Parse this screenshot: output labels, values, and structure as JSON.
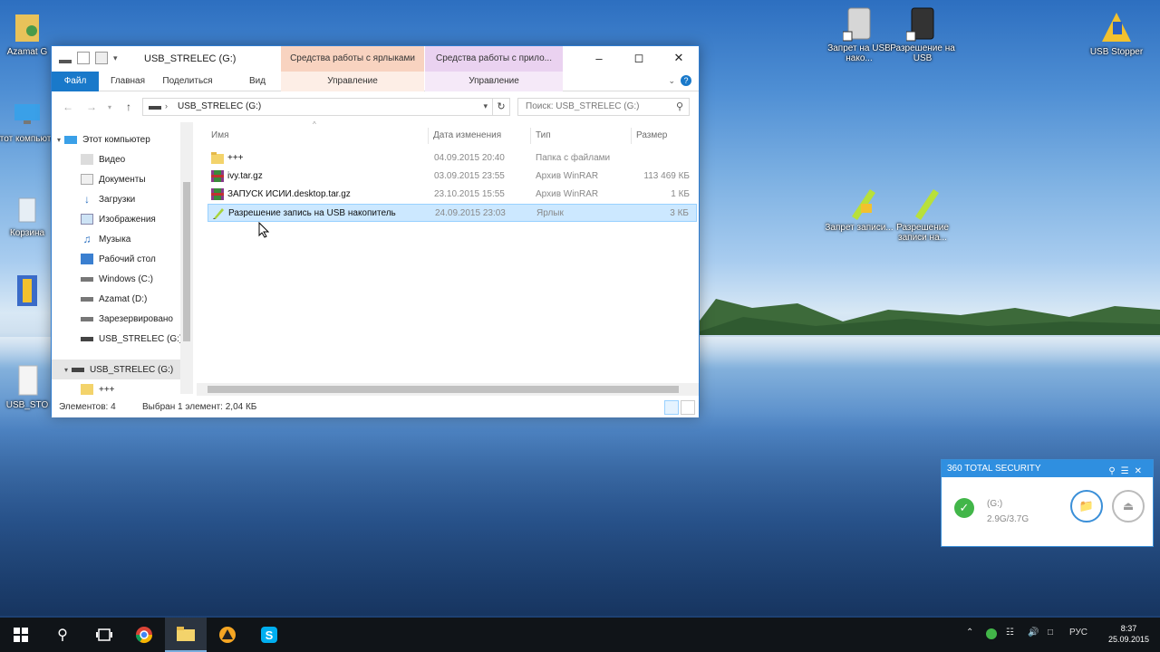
{
  "desktop": {
    "icons": [
      {
        "label": "Azamat G",
        "icon": "user-folder-icon"
      },
      {
        "label": "Этот компьютер",
        "icon": "computer-icon"
      },
      {
        "label": "Корзина",
        "icon": "recycle-bin-icon"
      },
      {
        "label": "",
        "icon": "archive-icon"
      },
      {
        "label": "USB_STO",
        "icon": "file-icon"
      },
      {
        "label": "Запрет на USB нако...",
        "icon": "usb-drive-shortcut-icon"
      },
      {
        "label": "Разрешение на USB",
        "icon": "usb-drive-shortcut-icon"
      },
      {
        "label": "USB Stopper",
        "icon": "usb-stopper-icon"
      },
      {
        "label": "Запрет записи...",
        "icon": "marker-lock-icon"
      },
      {
        "label": "Разрешение записи на...",
        "icon": "marker-icon"
      }
    ]
  },
  "explorer": {
    "title": "USB_STRELEC (G:)",
    "context_tabs": [
      "Средства работы с ярлыками",
      "Средства работы с прило..."
    ],
    "ribbon_tabs": [
      "Файл",
      "Главная",
      "Поделиться",
      "Вид",
      "Управление",
      "Управление"
    ],
    "address": "USB_STRELEC (G:)",
    "search_placeholder": "Поиск: USB_STRELEC (G:)",
    "nav_items": [
      "Этот компьютер",
      "Видео",
      "Документы",
      "Загрузки",
      "Изображения",
      "Музыка",
      "Рабочий стол",
      "Windows (C:)",
      "Azamat (D:)",
      "Зарезервировано",
      "USB_STRELEC (G:)",
      "USB_STRELEC (G:)",
      "+++"
    ],
    "columns": [
      "Имя",
      "Дата изменения",
      "Тип",
      "Размер"
    ],
    "files": [
      {
        "name": "+++",
        "date": "04.09.2015 20:40",
        "type": "Папка с файлами",
        "size": "",
        "icon": "folder-icon"
      },
      {
        "name": "ivy.tar.gz",
        "date": "03.09.2015 23:55",
        "type": "Архив WinRAR",
        "size": "113 469 КБ",
        "icon": "winrar-icon"
      },
      {
        "name": "ЗАПУСК ИСИИ.desktop.tar.gz",
        "date": "23.10.2015 15:55",
        "type": "Архив WinRAR",
        "size": "1 КБ",
        "icon": "winrar-icon"
      },
      {
        "name": "Разрешение запись на USB накопитель",
        "date": "24.09.2015 23:03",
        "type": "Ярлык",
        "size": "3 КБ",
        "icon": "shortcut-marker-icon"
      }
    ],
    "status_count": "Элементов: 4",
    "status_selected": "Выбран 1 элемент: 2,04 КБ"
  },
  "security_widget": {
    "title": "360 TOTAL SECURITY",
    "drive": "(G:)",
    "usage": "2.9G/3.7G"
  },
  "taskbar": {
    "language": "РУС",
    "time": "8:37",
    "date": "25.09.2015"
  }
}
